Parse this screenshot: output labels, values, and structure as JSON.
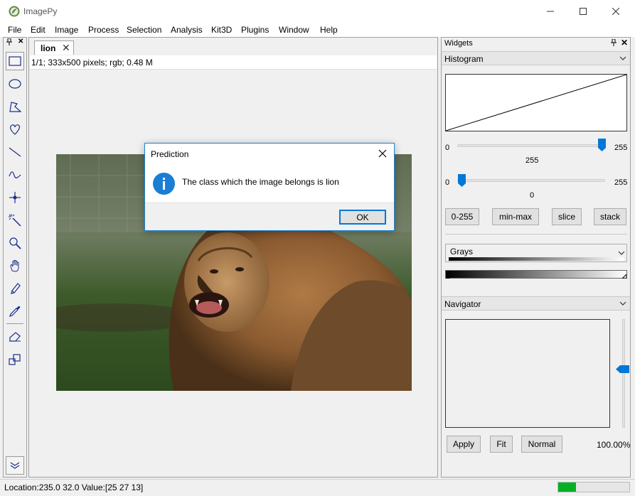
{
  "window": {
    "title": "ImagePy"
  },
  "menu": [
    "File",
    "Edit",
    "Image",
    "Process",
    "Selection",
    "Analysis",
    "Kit3D",
    "Plugins",
    "Window",
    "Help"
  ],
  "toolbar": {
    "tools": [
      "rectangle-tool",
      "ellipse-tool",
      "polygon-tool",
      "freehand-tool",
      "line-tool",
      "polyline-tool",
      "point-tool",
      "magic-wand-tool",
      "zoom-tool",
      "hand-tool",
      "pencil-tool",
      "color-picker-tool",
      "eraser-tool",
      "copy-tool",
      "more-tools"
    ]
  },
  "canvas": {
    "tab_label": "lion",
    "info": "1/1;  333x500 pixels; rgb; 0.48 M"
  },
  "widgets": {
    "title": "Widgets",
    "histogram": {
      "title": "Histogram",
      "slider_high": {
        "min": "0",
        "max": "255",
        "value": "255"
      },
      "slider_low": {
        "min": "0",
        "max": "255",
        "value": "0"
      },
      "buttons": [
        "0-255",
        "min-max",
        "slice",
        "stack"
      ]
    },
    "lut": {
      "selected": "Grays"
    },
    "navigator": {
      "title": "Navigator",
      "buttons": [
        "Apply",
        "Fit",
        "Normal"
      ],
      "zoom": "100.00%"
    }
  },
  "status": {
    "text": "Location:235.0 32.0  Value:[25 27 13]",
    "progress": 0.25
  },
  "dialog": {
    "title": "Prediction",
    "message": "The class which the image belongs is lion",
    "ok_label": "OK"
  },
  "colors": {
    "accent": "#0078d7",
    "progress": "#06b025",
    "info_icon": "#1a7fd4"
  }
}
